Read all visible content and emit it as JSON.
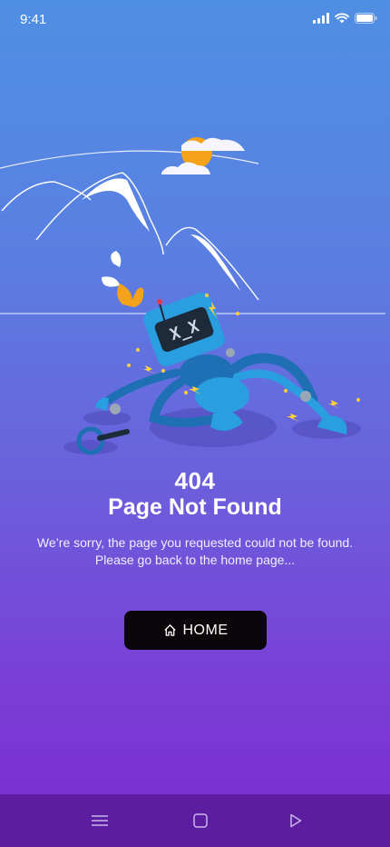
{
  "status_bar": {
    "time": "9:41"
  },
  "error": {
    "code": "404",
    "title": "Page Not Found",
    "message": "We’re sorry, the page you requested could not be found. Please go back to the home page..."
  },
  "home_button": {
    "label": "HOME",
    "icon": "home-icon"
  },
  "nav_bar": {
    "items": [
      "menu-icon",
      "square-icon",
      "back-triangle-icon"
    ]
  },
  "colors": {
    "button": "#0a0609",
    "nav_bar": "#5d1da0",
    "robot": "#2a9fe0",
    "sun": "#f5a21b"
  }
}
